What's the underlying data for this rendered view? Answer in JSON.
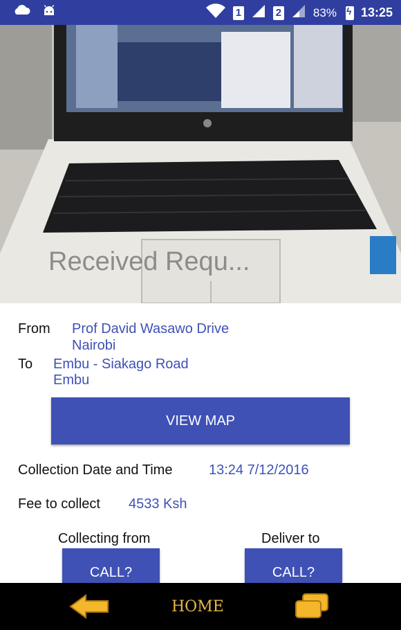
{
  "status_bar": {
    "sim1": "1",
    "sim2": "2",
    "battery_percent": "83%",
    "time": "13:25"
  },
  "hero": {
    "title": "Received Requ..."
  },
  "route": {
    "from_label": "From",
    "from_line1": "Prof David Wasawo Drive",
    "from_line2": "Nairobi",
    "to_label": "To",
    "to_line1": "Embu - Siakago Road",
    "to_line2": "Embu"
  },
  "view_map_label": "VIEW MAP",
  "collection": {
    "label": "Collection Date and Time",
    "value": "13:24 7/12/2016"
  },
  "fee": {
    "label": "Fee to collect",
    "value": "4533 Ksh"
  },
  "contacts": {
    "collecting_from_label": "Collecting from",
    "deliver_to_label": "Deliver to",
    "call_label": "CALL?"
  },
  "nav": {
    "home_label": "HOME"
  },
  "colors": {
    "primary": "#3f51b5",
    "status_bar": "#303f9f",
    "nav_accent": "#e8b84a"
  }
}
